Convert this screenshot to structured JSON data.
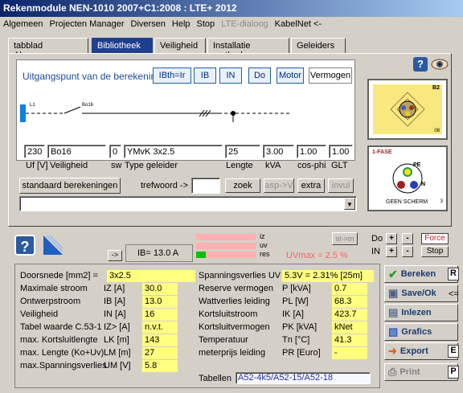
{
  "window": {
    "title": "Rekenmodule NEN-1010 2007+C1:2008 : LTE+ 2012"
  },
  "menu": [
    "Algemeen",
    "Projecten Manager",
    "Diversen",
    "Help",
    "Stop",
    "LTE-dialoog",
    "KabelNet <-"
  ],
  "tabs": [
    "tabblad Algemeen",
    "Bibliotheek",
    "Veiligheid",
    "Installatie methode",
    "Geleiders"
  ],
  "calc": {
    "label": "Uitgangspunt van de berekening",
    "buttons": [
      "IBth=Ir",
      "IB",
      "IN",
      "Do",
      "Motor",
      "Vermogen"
    ]
  },
  "diagram": {
    "left_label": "L1",
    "mid_label": "Bo16"
  },
  "inputs": {
    "uf": "230",
    "veiligheid": "Bo16",
    "sw": "0",
    "type": "YMvK 3x2.5",
    "lengte": "25",
    "kva": "3.00",
    "cosphi": "1.00",
    "glt": "1.00",
    "lbl_uf": "Uf [V]",
    "lbl_veil": "Veiligheid",
    "lbl_sw": "sw",
    "lbl_type": "Type geleider",
    "lbl_lengte": "Lengte",
    "lbl_kva": "kVA",
    "lbl_cos": "cos-phi",
    "lbl_glt": "GLT"
  },
  "search": {
    "std_button": "standaard berekeningen",
    "label": "trefwoord ->",
    "value": "",
    "zoek": "zoek",
    "asp": "asp->V",
    "extra": "extra",
    "invul": "invul"
  },
  "cable1": {
    "code": "B2",
    "num": "08"
  },
  "cable2": {
    "fase": "1-FASE",
    "pe": "PE",
    "n": "N",
    "scherm": "GEEN SCHERM",
    "num": "3"
  },
  "status": {
    "arrow": "->",
    "ib": "IB=  13.0 A",
    "iz": "iz",
    "uv": "uv",
    "res": "res",
    "uvmax": "UVmax = 2.5 %",
    "stm": "st->m",
    "do": "Do",
    "in": "IN",
    "plus": "+",
    "minus": "-",
    "force": "Force",
    "stop": "Stop"
  },
  "results": {
    "left": [
      {
        "label": "Doorsnede [mm2] =",
        "sym": "",
        "val": "3x2.5"
      },
      {
        "label": "Maximale stroom",
        "sym": "IZ  [A]",
        "val": "30.0"
      },
      {
        "label": "Ontwerpstroom",
        "sym": "IB  [A]",
        "val": "13.0"
      },
      {
        "label": "Veiligheid",
        "sym": "IN  [A]",
        "val": "16"
      },
      {
        "label": "Tabel waarde C.53-1",
        "sym": "IZ> [A]",
        "val": "n.v.t."
      },
      {
        "label": "max. Kortsluitlengte",
        "sym": "LK  [m]",
        "val": "143"
      },
      {
        "label": "max. Lengte (Ko+Uv)",
        "sym": "LM  [m]",
        "val": "27"
      },
      {
        "label": "max.Spanningsverlies",
        "sym": "UM [V]",
        "val": "5.8"
      }
    ],
    "uv_label": "Spanningsverlies UV =",
    "uv_val": "5.3V = 2.31% [25m]",
    "right": [
      {
        "label": "Reserve vermogen",
        "sym": "P   [kVA]",
        "val": "0.7"
      },
      {
        "label": "Wattverlies leiding",
        "sym": "PL  [W]",
        "val": "68.3"
      },
      {
        "label": "Kortsluitstroom",
        "sym": "IK  [A]",
        "val": "423.7"
      },
      {
        "label": "Kortsluitvermogen",
        "sym": "PK [kVA]",
        "val": "kNet"
      },
      {
        "label": "Temperatuur",
        "sym": "Tn  [°C]",
        "val": "41.3"
      },
      {
        "label": "meterprijs leiding",
        "sym": "PR [Euro]",
        "val": "-"
      }
    ],
    "tabellen_label": "Tabellen",
    "tabellen_val": "A52-4k5/A52-15/A52-18"
  },
  "actions": {
    "bereken": "Bereken",
    "save": "Save/Ok",
    "inlezen": "Inlezen",
    "grafics": "Grafics",
    "export": "Export",
    "print": "Print",
    "r": "R",
    "arrow": "<=",
    "e": "E",
    "p": "P"
  },
  "colors": {
    "accent": "#1f3f8f",
    "yellow": "#ffff80",
    "uvmax": "#ff6060"
  }
}
